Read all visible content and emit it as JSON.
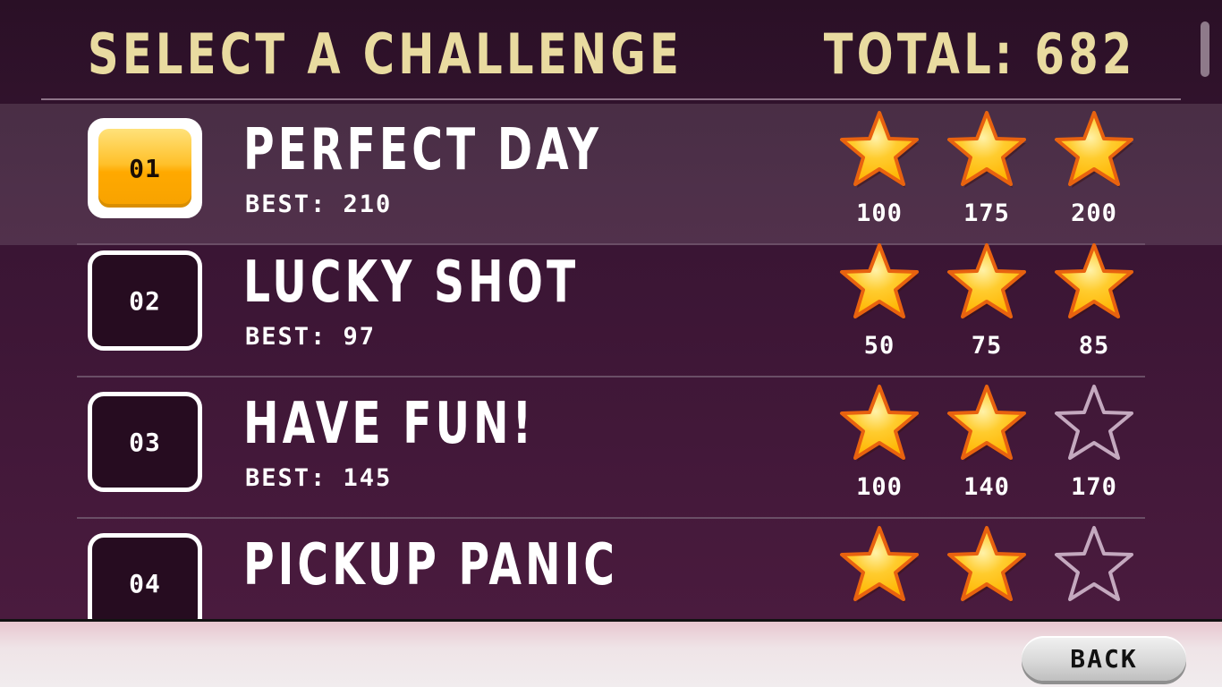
{
  "header": {
    "title": "SELECT A CHALLENGE",
    "total": "TOTAL: 682"
  },
  "challenges": [
    {
      "number": "01",
      "name": "PERFECT DAY",
      "best": "BEST: 210",
      "selected": true,
      "stars": [
        {
          "threshold": "100",
          "earned": true
        },
        {
          "threshold": "175",
          "earned": true
        },
        {
          "threshold": "200",
          "earned": true
        }
      ]
    },
    {
      "number": "02",
      "name": "LUCKY SHOT",
      "best": "BEST: 97",
      "selected": false,
      "stars": [
        {
          "threshold": "50",
          "earned": true
        },
        {
          "threshold": "75",
          "earned": true
        },
        {
          "threshold": "85",
          "earned": true
        }
      ]
    },
    {
      "number": "03",
      "name": "HAVE FUN!",
      "best": "BEST: 145",
      "selected": false,
      "stars": [
        {
          "threshold": "100",
          "earned": true
        },
        {
          "threshold": "140",
          "earned": true
        },
        {
          "threshold": "170",
          "earned": false
        }
      ]
    },
    {
      "number": "04",
      "name": "PICKUP PANIC",
      "best": "",
      "selected": false,
      "stars": [
        {
          "threshold": "",
          "earned": true
        },
        {
          "threshold": "",
          "earned": true
        },
        {
          "threshold": "",
          "earned": false
        }
      ]
    }
  ],
  "footer": {
    "back_label": "BACK"
  },
  "colors": {
    "header_text": "#e9dba0",
    "star_gold": "#ffb400",
    "star_outline": "#c4a9bf",
    "badge_active": "#ffc02a"
  }
}
